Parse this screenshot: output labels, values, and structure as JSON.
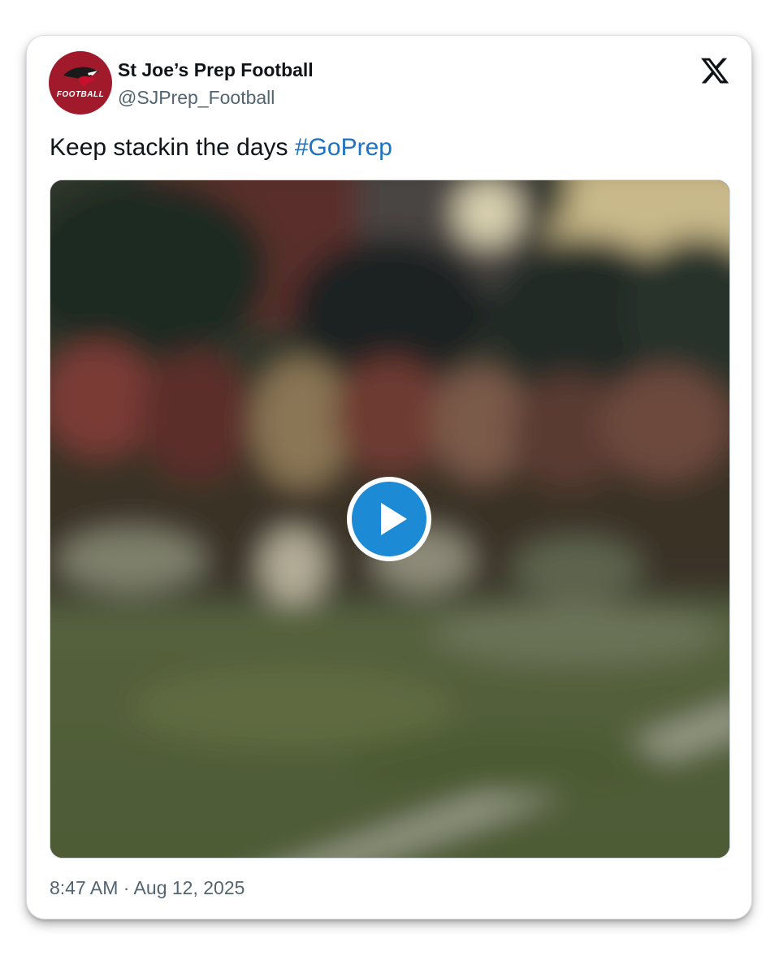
{
  "author": {
    "display_name": "St Joe’s Prep Football",
    "handle": "@SJPrep_Football",
    "avatar_text": "FOOTBALL",
    "avatar_color": "#a11a2c"
  },
  "tweet": {
    "text": "Keep stackin the days ",
    "hashtag": "#GoPrep",
    "timestamp": "8:47 AM · Aug 12, 2025"
  },
  "media": {
    "type": "video",
    "description_icon": "play-icon",
    "play_button_color": "#1d8ad6"
  },
  "brand": {
    "logo_icon": "x-logo-icon",
    "link_color": "#1d72c4"
  }
}
